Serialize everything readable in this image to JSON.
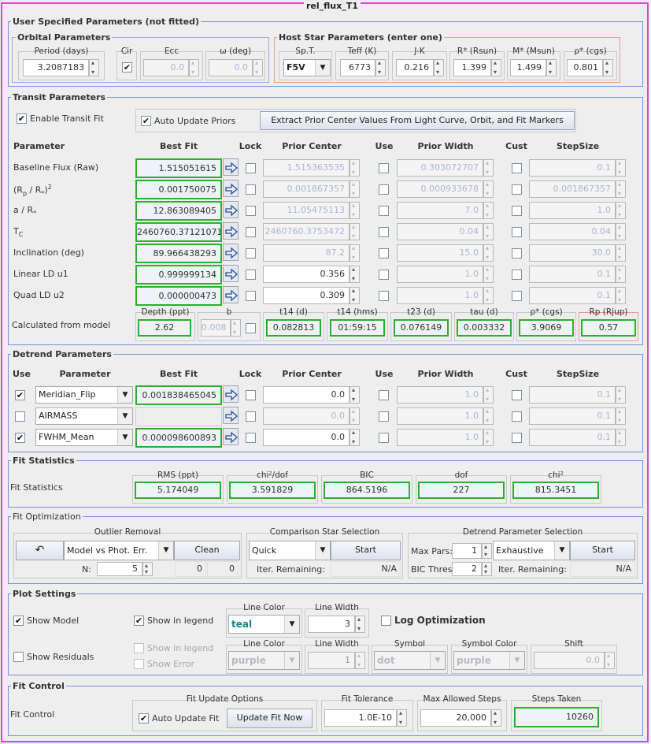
{
  "window_title": "rel_flux_T1",
  "user_params": {
    "title": "User Specified Parameters (not fitted)",
    "orbital": {
      "title": "Orbital Parameters",
      "period_label": "Period (days)",
      "period": "3.2087183",
      "cir_label": "Cir",
      "ecc_label": "Ecc",
      "ecc": "0.0",
      "omega_label": "ω (deg)",
      "omega": "0.0"
    },
    "host": {
      "title": "Host Star Parameters (enter one)",
      "spt_label": "Sp.T.",
      "spt": "F5V",
      "teff_label": "Teff (K)",
      "teff": "6773",
      "jk_label": "J-K",
      "jk": "0.216",
      "rstar_label": "R* (Rsun)",
      "rstar": "1.399",
      "mstar_label": "M* (Msun)",
      "mstar": "1.499",
      "rho_label": "ρ* (cgs)",
      "rho": "0.801"
    }
  },
  "transit": {
    "title": "Transit Parameters",
    "enable_fit": "Enable Transit Fit",
    "auto_update": "Auto Update Priors",
    "extract_btn": "Extract Prior Center Values From Light Curve, Orbit, and Fit Markers",
    "headers": {
      "parameter": "Parameter",
      "best_fit": "Best Fit",
      "lock": "Lock",
      "prior_center": "Prior Center",
      "use": "Use",
      "prior_width": "Prior Width",
      "cust": "Cust",
      "stepsize": "StepSize"
    },
    "rows": [
      {
        "name": "Baseline Flux (Raw)",
        "best": "1.515051615",
        "center": "1.515363535",
        "width": "0.303072707",
        "step": "0.1"
      },
      {
        "name": "(Rp / R*)2",
        "best": "0.001750075",
        "center": "0.001867357",
        "width": "0.000933678",
        "step": "0.001867357"
      },
      {
        "name": "a / R*",
        "best": "12.863089405",
        "center": "11.05475113",
        "width": "7.0",
        "step": "1.0"
      },
      {
        "name": "TC",
        "best": "2460760.371210715",
        "center": "2460760.3753472",
        "width": "0.04",
        "step": "0.04"
      },
      {
        "name": "Inclination (deg)",
        "best": "89.966438293",
        "center": "87.2",
        "width": "15.0",
        "step": "30.0"
      },
      {
        "name": "Linear LD u1",
        "best": "0.999999134",
        "center": "0.356",
        "width": "1.0",
        "step": "0.1"
      },
      {
        "name": "Quad LD u2",
        "best": "0.000000473",
        "center": "0.309",
        "width": "1.0",
        "step": "0.1"
      }
    ],
    "calc": {
      "label": "Calculated from model",
      "depth_label": "Depth (ppt)",
      "depth": "2.62",
      "b_label": "b",
      "b": "0.008",
      "t14_label": "t14 (d)",
      "t14": "0.082813",
      "t14hms_label": "t14 (hms)",
      "t14hms": "01:59:15",
      "t23_label": "t23 (d)",
      "t23": "0.076149",
      "tau_label": "tau (d)",
      "tau": "0.003332",
      "rho_label": "ρ* (cgs)",
      "rho": "3.9069",
      "rp_label": "Rp (Rjup)",
      "rp": "0.57"
    }
  },
  "detrend": {
    "title": "Detrend Parameters",
    "headers": {
      "use": "Use",
      "parameter": "Parameter",
      "best_fit": "Best Fit",
      "lock": "Lock",
      "prior_center": "Prior Center",
      "use2": "Use",
      "prior_width": "Prior Width",
      "cust": "Cust",
      "stepsize": "StepSize"
    },
    "rows": [
      {
        "name": "Meridian_Flip",
        "best": "0.001838465045",
        "center": "0.0",
        "width": "1.0",
        "step": "0.1"
      },
      {
        "name": "AIRMASS",
        "best": "",
        "center": "0.0",
        "width": "1.0",
        "step": "0.1"
      },
      {
        "name": "FWHM_Mean",
        "best": "0.000098600893",
        "center": "0.0",
        "width": "1.0",
        "step": "0.1"
      }
    ]
  },
  "fit_stats": {
    "title": "Fit Statistics",
    "label": "Fit Statistics",
    "rms_label": "RMS (ppt)",
    "rms": "5.174049",
    "chidof_label": "chi²/dof",
    "chidof": "3.591829",
    "bic_label": "BIC",
    "bic": "864.5196",
    "dof_label": "dof",
    "dof": "227",
    "chi2_label": "chi²",
    "chi2": "815.3451"
  },
  "fit_opt": {
    "title": "Fit Optimization",
    "outlier": {
      "title": "Outlier Removal",
      "mode": "Model vs Phot. Err.",
      "clean": "Clean",
      "n_label": "N:",
      "n": "5",
      "v1": "0",
      "v2": "0"
    },
    "comp": {
      "title": "Comparison Star Selection",
      "mode": "Quick",
      "start": "Start",
      "iter_label": "Iter. Remaining:",
      "iter": "N/A"
    },
    "detrend_sel": {
      "title": "Detrend Parameter Selection",
      "maxpars_label": "Max Pars:",
      "maxpars": "1",
      "mode": "Exhaustive",
      "start": "Start",
      "bic_label": "BIC Thres:",
      "bic": "2",
      "iter_label": "Iter. Remaining:",
      "iter": "N/A"
    }
  },
  "plot": {
    "title": "Plot Settings",
    "show_model": "Show Model",
    "show_legend": "Show in legend",
    "line_color_label": "Line Color",
    "line_color": "teal",
    "line_width_label": "Line Width",
    "line_width": "3",
    "log_opt": "Log Optimization",
    "show_residuals": "Show Residuals",
    "res_legend": "Show in legend",
    "res_error": "Show Error",
    "res_color_label": "Line Color",
    "res_color": "purple",
    "res_width_label": "Line Width",
    "res_width": "1",
    "symbol_label": "Symbol",
    "symbol": "dot",
    "symcolor_label": "Symbol Color",
    "symcolor": "purple",
    "shift_label": "Shift",
    "shift": "0.0"
  },
  "fit_control": {
    "title": "Fit Control",
    "label": "Fit Control",
    "opts_title": "Fit Update Options",
    "auto_fit": "Auto Update Fit",
    "update_now": "Update Fit Now",
    "tol_label": "Fit Tolerance",
    "tol": "1.0E-10",
    "max_label": "Max Allowed Steps",
    "max": "20,000",
    "taken_label": "Steps Taken",
    "taken": "10260"
  }
}
